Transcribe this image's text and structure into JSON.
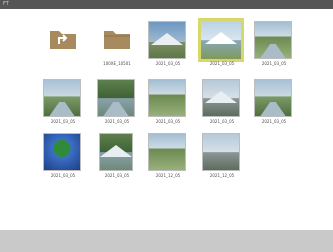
{
  "window": {
    "title": "FT"
  },
  "items": [
    {
      "kind": "folder-up",
      "label": ""
    },
    {
      "kind": "folder",
      "label": "100XE_10501"
    },
    {
      "kind": "photo",
      "scene": "sky1",
      "label": "2021_03_05"
    },
    {
      "kind": "photo",
      "scene": "sky2",
      "label": "2021_03_05",
      "selected": true
    },
    {
      "kind": "photo",
      "scene": "park",
      "label": "2021_03_05"
    },
    {
      "kind": "photo",
      "scene": "valley",
      "label": "2021_03_05"
    },
    {
      "kind": "photo",
      "scene": "trees",
      "label": "2021_03_05"
    },
    {
      "kind": "photo",
      "scene": "park",
      "label": "2021_03_05"
    },
    {
      "kind": "photo",
      "scene": "town",
      "label": "2021_03_05"
    },
    {
      "kind": "photo",
      "scene": "valley",
      "label": "2021_03_05"
    },
    {
      "kind": "photo",
      "scene": "night",
      "label": "2021_03_05"
    },
    {
      "kind": "photo",
      "scene": "trees",
      "label": "2021_03_05"
    },
    {
      "kind": "photo",
      "scene": "park",
      "label": "2021_12_05"
    },
    {
      "kind": "photo",
      "scene": "town",
      "label": "2021_12_05"
    }
  ],
  "colors": {
    "folder": "#a88a5f",
    "selection": "#d8d86a"
  }
}
